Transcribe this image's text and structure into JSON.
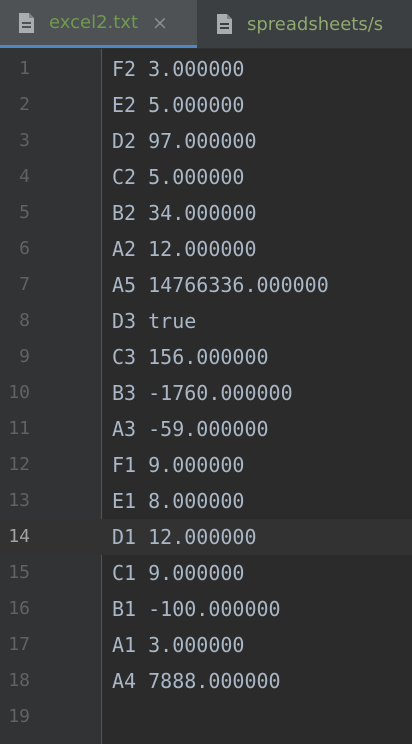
{
  "tabs": [
    {
      "label": "excel2.txt",
      "icon": "file-text-icon",
      "active": true,
      "close": "×"
    },
    {
      "label": "spreadsheets/s",
      "icon": "file-text-icon",
      "active": false
    }
  ],
  "editor": {
    "current_line": 14,
    "lines": [
      {
        "n": "1",
        "text": "F2 3.000000"
      },
      {
        "n": "2",
        "text": "E2 5.000000"
      },
      {
        "n": "3",
        "text": "D2 97.000000"
      },
      {
        "n": "4",
        "text": "C2 5.000000"
      },
      {
        "n": "5",
        "text": "B2 34.000000"
      },
      {
        "n": "6",
        "text": "A2 12.000000"
      },
      {
        "n": "7",
        "text": "A5 14766336.000000"
      },
      {
        "n": "8",
        "text": "D3 true"
      },
      {
        "n": "9",
        "text": "C3 156.000000"
      },
      {
        "n": "10",
        "text": "B3 -1760.000000"
      },
      {
        "n": "11",
        "text": "A3 -59.000000"
      },
      {
        "n": "12",
        "text": "F1 9.000000"
      },
      {
        "n": "13",
        "text": "E1 8.000000"
      },
      {
        "n": "14",
        "text": "D1 12.000000"
      },
      {
        "n": "15",
        "text": "C1 9.000000"
      },
      {
        "n": "16",
        "text": "B1 -100.000000"
      },
      {
        "n": "17",
        "text": "A1 3.000000"
      },
      {
        "n": "18",
        "text": "A4 7888.000000"
      },
      {
        "n": "19",
        "text": ""
      }
    ]
  },
  "colors": {
    "background": "#2b2b2b",
    "gutter": "#313335",
    "tab_bar": "#3c3f41",
    "code_text": "#a9b7c6",
    "line_number": "#606366",
    "tab_label": "#6e9b4f"
  }
}
